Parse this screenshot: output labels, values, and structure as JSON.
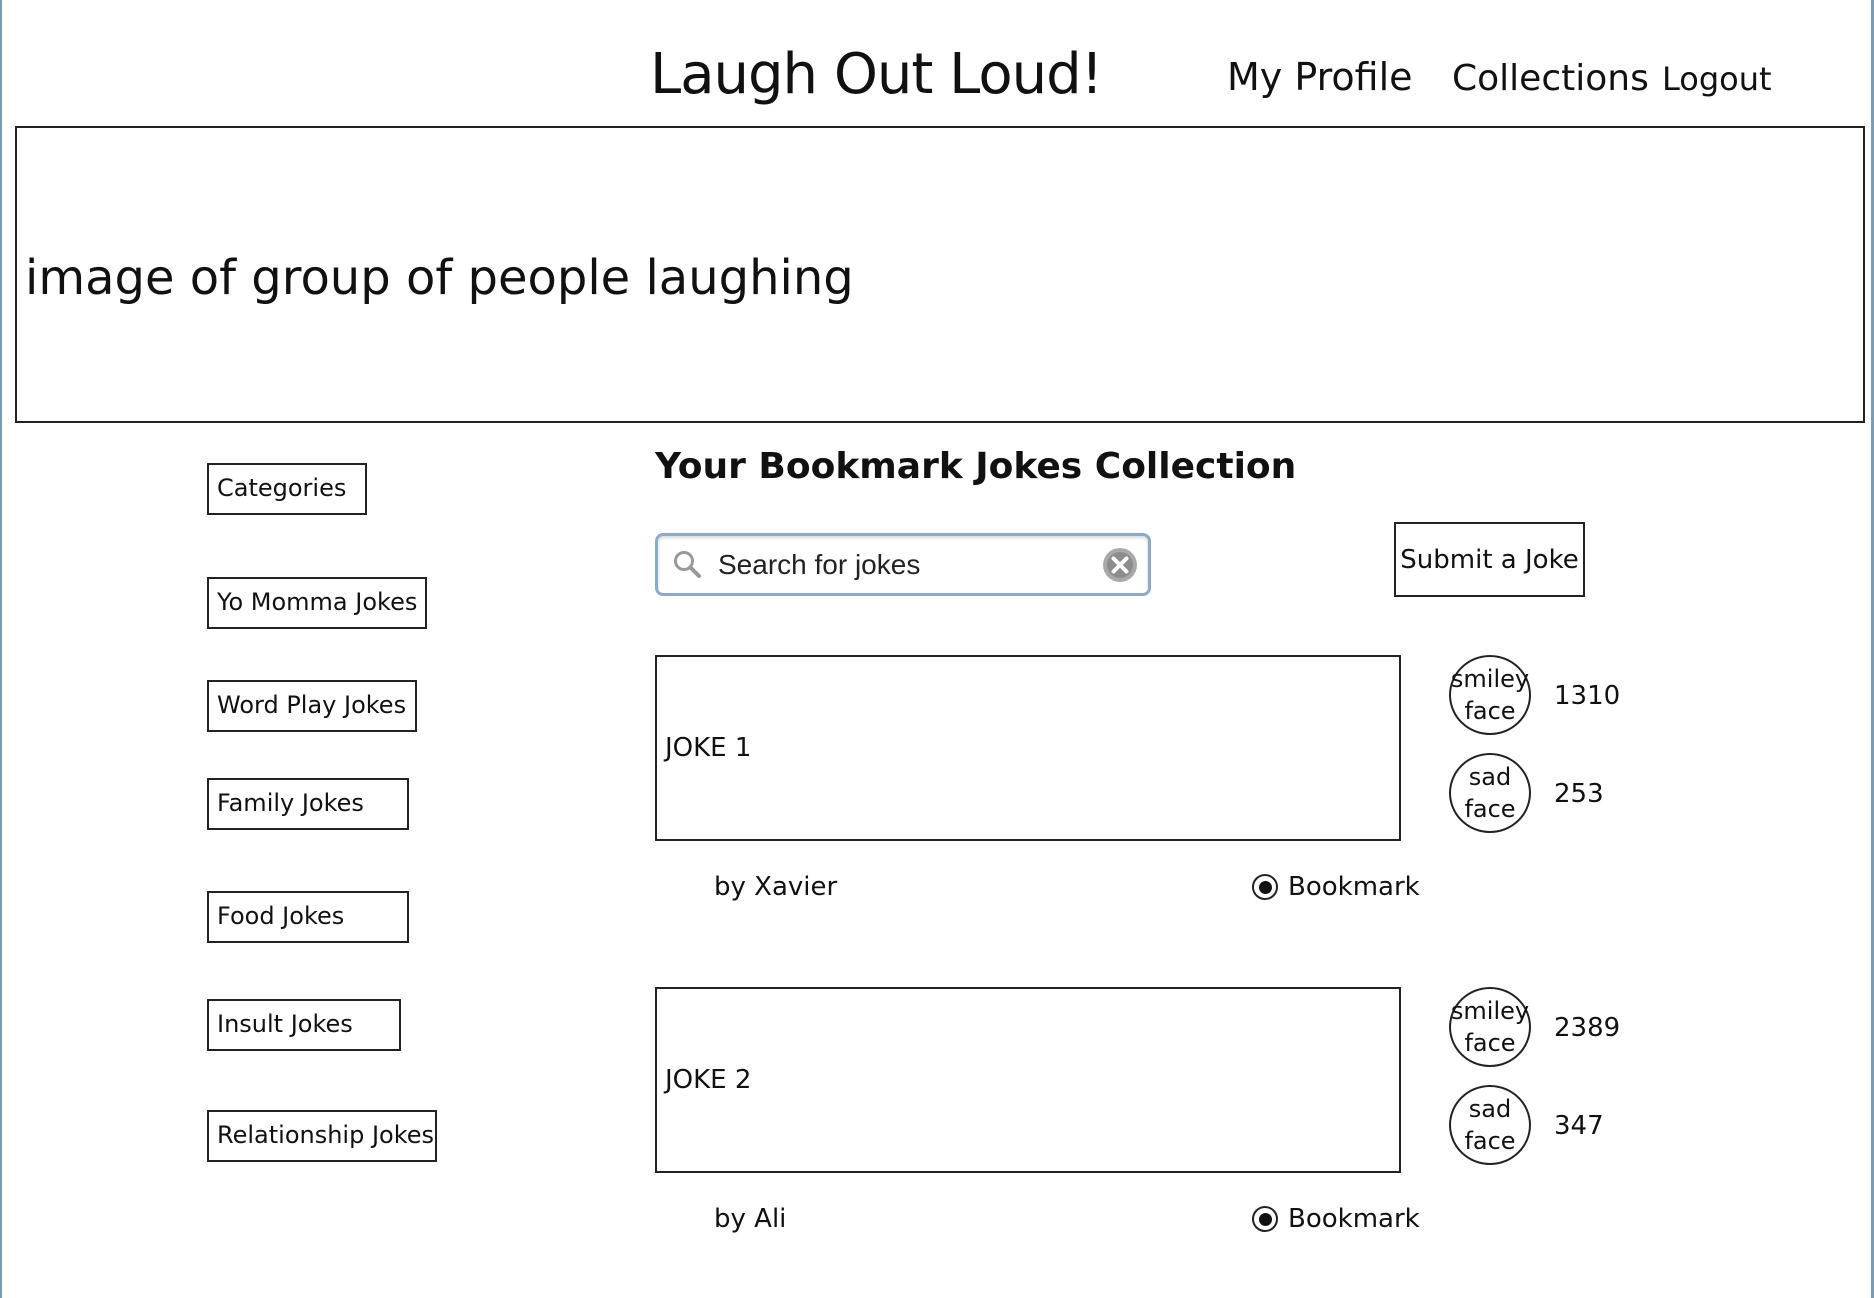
{
  "header": {
    "title": "Laugh Out Loud!",
    "nav": {
      "profile": "My Profile",
      "collections": "Collections",
      "logout": "Logout"
    }
  },
  "hero": {
    "text": "image of group of people laughing"
  },
  "sidebar": {
    "heading": "Categories",
    "items": [
      {
        "label": "Yo Momma Jokes"
      },
      {
        "label": "Word Play Jokes"
      },
      {
        "label": "Family Jokes"
      },
      {
        "label": "Food Jokes"
      },
      {
        "label": "Insult Jokes"
      },
      {
        "label": "Relationship Jokes"
      }
    ]
  },
  "main": {
    "title": "Your Bookmark Jokes Collection",
    "search": {
      "placeholder": "Search for jokes",
      "value": ""
    },
    "submit_label": "Submit a Joke",
    "jokes": [
      {
        "text": "JOKE 1",
        "author": "by Xavier",
        "bookmark_label": "Bookmark",
        "smiley": {
          "label_line1": "smiley",
          "label_line2": "face",
          "count": "1310"
        },
        "sad": {
          "label_line1": "sad",
          "label_line2": "face",
          "count": "253"
        }
      },
      {
        "text": "JOKE 2",
        "author": "by Ali",
        "bookmark_label": "Bookmark",
        "smiley": {
          "label_line1": "smiley",
          "label_line2": "face",
          "count": "2389"
        },
        "sad": {
          "label_line1": "sad",
          "label_line2": "face",
          "count": "347"
        }
      }
    ]
  },
  "icons": {
    "search": "search-icon",
    "clear": "clear-icon",
    "bookmark_radio": "radio-selected-icon"
  },
  "colors": {
    "frame": "#7d9bb3",
    "search_border": "#8faac8",
    "ink": "#111111"
  }
}
